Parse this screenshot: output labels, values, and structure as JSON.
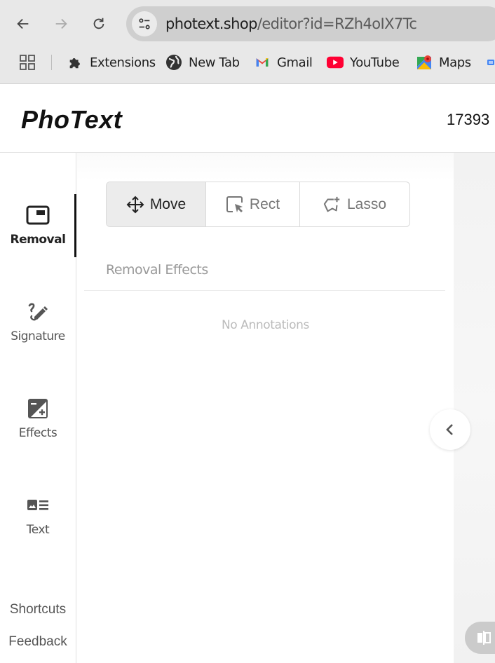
{
  "browser": {
    "url_host": "photext.shop",
    "url_path": "/editor?id=RZh4oIX7Tc",
    "bookmarks": [
      {
        "label": "Extensions",
        "icon": "puzzle-icon"
      },
      {
        "label": "New Tab",
        "icon": "globe-icon"
      },
      {
        "label": "Gmail",
        "icon": "gmail-icon"
      },
      {
        "label": "YouTube",
        "icon": "youtube-icon"
      },
      {
        "label": "Maps",
        "icon": "maps-icon"
      }
    ]
  },
  "header": {
    "logo": "PhoText",
    "id_text": "17393"
  },
  "sidebar": {
    "items": [
      {
        "label": "Removal",
        "icon": "removal-icon",
        "active": true
      },
      {
        "label": "Signature",
        "icon": "signature-icon",
        "active": false
      },
      {
        "label": "Effects",
        "icon": "effects-icon",
        "active": false
      },
      {
        "label": "Text",
        "icon": "text-icon",
        "active": false
      }
    ],
    "links": [
      "Shortcuts",
      "Feedback"
    ]
  },
  "panel": {
    "tools": [
      {
        "label": "Move",
        "icon": "move-icon",
        "active": true
      },
      {
        "label": "Rect",
        "icon": "rect-select-icon",
        "active": false
      },
      {
        "label": "Lasso",
        "icon": "lasso-icon",
        "active": false
      }
    ],
    "section_title": "Removal Effects",
    "empty_text": "No Annotations"
  },
  "colors": {
    "active_indicator": "#111111",
    "youtube_red": "#ff0033"
  }
}
